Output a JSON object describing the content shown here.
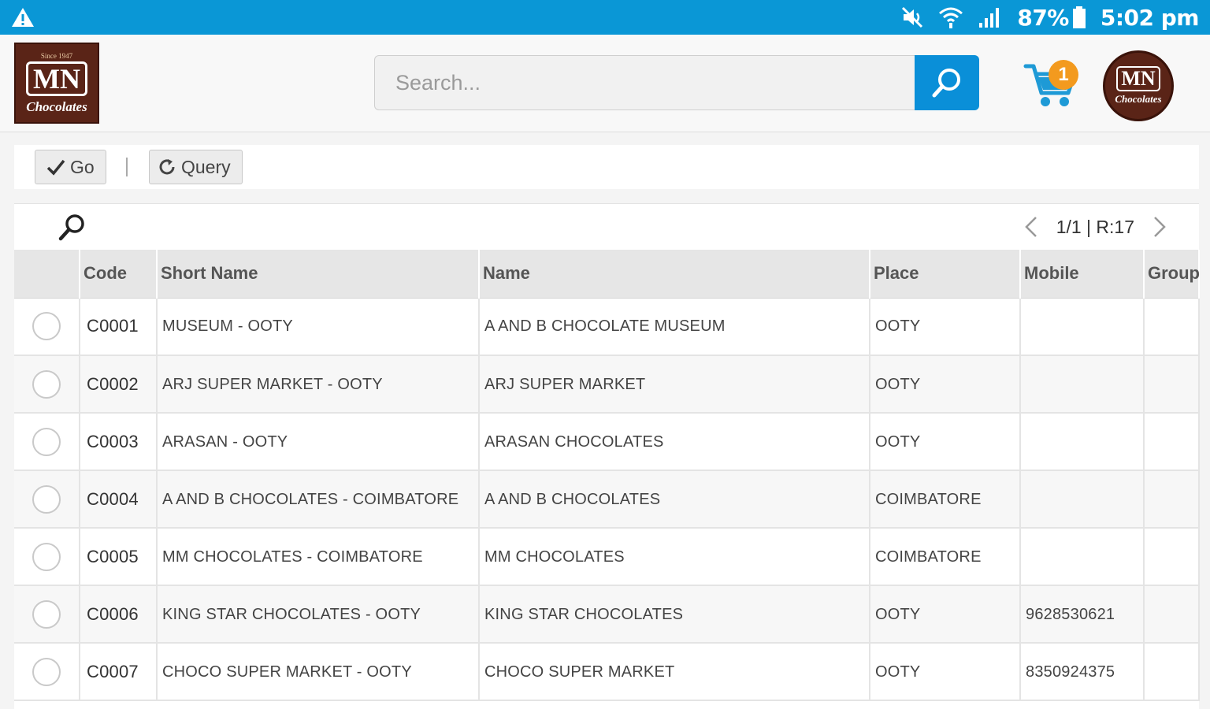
{
  "status_bar": {
    "battery": "87%",
    "time": "5:02 pm",
    "icons": [
      "warning-icon",
      "mute-icon",
      "wifi-icon",
      "signal-icon",
      "battery-icon"
    ]
  },
  "header": {
    "logo": {
      "since": "Since 1947",
      "brand": "MN",
      "tagline": "Chocolates"
    },
    "search": {
      "placeholder": "Search..."
    },
    "cart": {
      "count": "1"
    }
  },
  "toolbar": {
    "go_label": "Go",
    "query_label": "Query"
  },
  "pager": {
    "text": "1/1 | R:17"
  },
  "table": {
    "columns": [
      "",
      "Code",
      "Short Name",
      "Name",
      "Place",
      "Mobile",
      "Group"
    ],
    "rows": [
      {
        "code": "C0001",
        "short_name": "MUSEUM - OOTY",
        "name": "A AND B CHOCOLATE MUSEUM",
        "place": "OOTY",
        "mobile": "",
        "group": ""
      },
      {
        "code": "C0002",
        "short_name": "ARJ SUPER MARKET - OOTY",
        "name": "ARJ SUPER MARKET",
        "place": "OOTY",
        "mobile": "",
        "group": ""
      },
      {
        "code": "C0003",
        "short_name": "ARASAN - OOTY",
        "name": "ARASAN CHOCOLATES",
        "place": "OOTY",
        "mobile": "",
        "group": ""
      },
      {
        "code": "C0004",
        "short_name": "A AND B CHOCOLATES - COIMBATORE",
        "name": "A AND B CHOCOLATES",
        "place": "COIMBATORE",
        "mobile": "",
        "group": ""
      },
      {
        "code": "C0005",
        "short_name": "MM CHOCOLATES - COIMBATORE",
        "name": "MM CHOCOLATES",
        "place": "COIMBATORE",
        "mobile": "",
        "group": ""
      },
      {
        "code": "C0006",
        "short_name": "KING STAR CHOCOLATES - OOTY",
        "name": "KING STAR CHOCOLATES",
        "place": "OOTY",
        "mobile": "9628530621",
        "group": ""
      },
      {
        "code": "C0007",
        "short_name": "CHOCO SUPER MARKET - OOTY",
        "name": "CHOCO SUPER MARKET",
        "place": "OOTY",
        "mobile": "8350924375",
        "group": ""
      }
    ]
  },
  "colors": {
    "status_bar": "#0a97d6",
    "search_button": "#0a8fd8",
    "cart_badge": "#f39a1e",
    "brand_brown": "#5a2417"
  }
}
